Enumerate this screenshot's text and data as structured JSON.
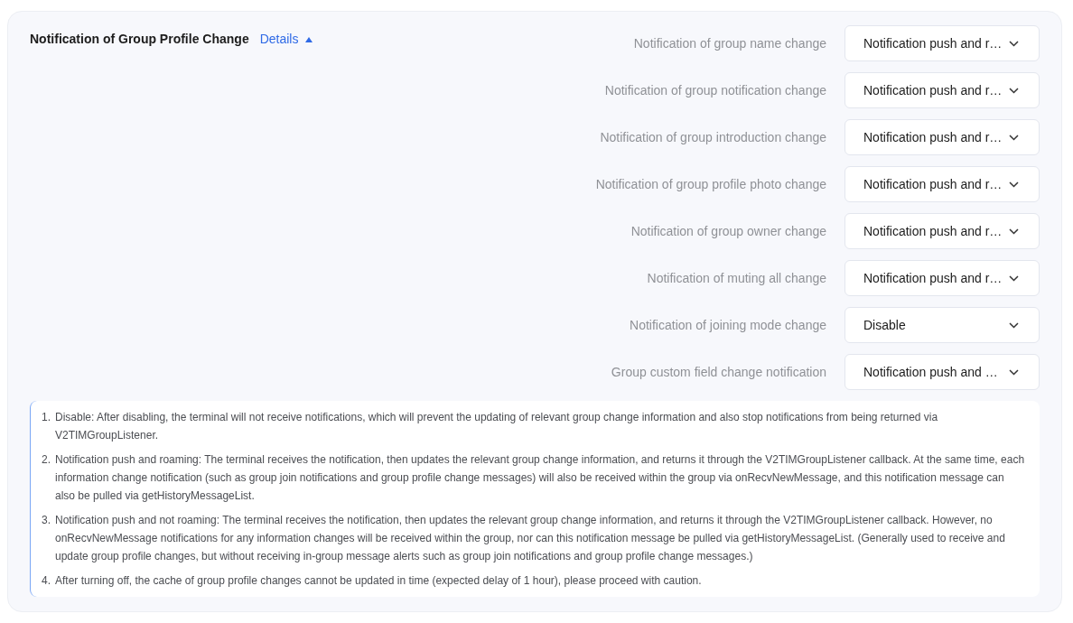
{
  "section": {
    "title": "Notification of Group Profile Change",
    "details_link": {
      "label": "Details",
      "expanded": true
    }
  },
  "settings": [
    {
      "label": "Notification of group name change",
      "value": "Notification push and r…"
    },
    {
      "label": "Notification of group notification change",
      "value": "Notification push and r…"
    },
    {
      "label": "Notification of group introduction change",
      "value": "Notification push and r…"
    },
    {
      "label": "Notification of group profile photo change",
      "value": "Notification push and r…"
    },
    {
      "label": "Notification of group owner change",
      "value": "Notification push and r…"
    },
    {
      "label": "Notification of muting all change",
      "value": "Notification push and r…"
    },
    {
      "label": "Notification of joining mode change",
      "value": "Disable"
    },
    {
      "label": "Group custom field change notification",
      "value": "Notification push and …"
    }
  ],
  "notes": [
    {
      "number": "1.",
      "text": "Disable: After disabling, the terminal will not receive notifications, which will prevent the updating of relevant group change information and also stop notifications from being returned via V2TIMGroupListener."
    },
    {
      "number": "2.",
      "text": "Notification push and roaming: The terminal receives the notification, then updates the relevant group change information, and returns it through the V2TIMGroupListener callback. At the same time, each information change notification (such as group join notifications and group profile change messages) will also be received within the group via onRecvNewMessage, and this notification message can also be pulled via getHistoryMessageList."
    },
    {
      "number": "3.",
      "text": "Notification push and not roaming: The terminal receives the notification, then updates the relevant group change information, and returns it through the V2TIMGroupListener callback. However, no onRecvNewMessage notifications for any information changes will be received within the group, nor can this notification message be pulled via getHistoryMessageList. (Generally used to receive and update group profile changes, but without receiving in-group message alerts such as group join notifications and group profile change messages.)"
    },
    {
      "number": "4.",
      "text": "After turning off, the cache of group profile changes cannot be updated in time (expected delay of 1 hour), please proceed with caution."
    }
  ]
}
